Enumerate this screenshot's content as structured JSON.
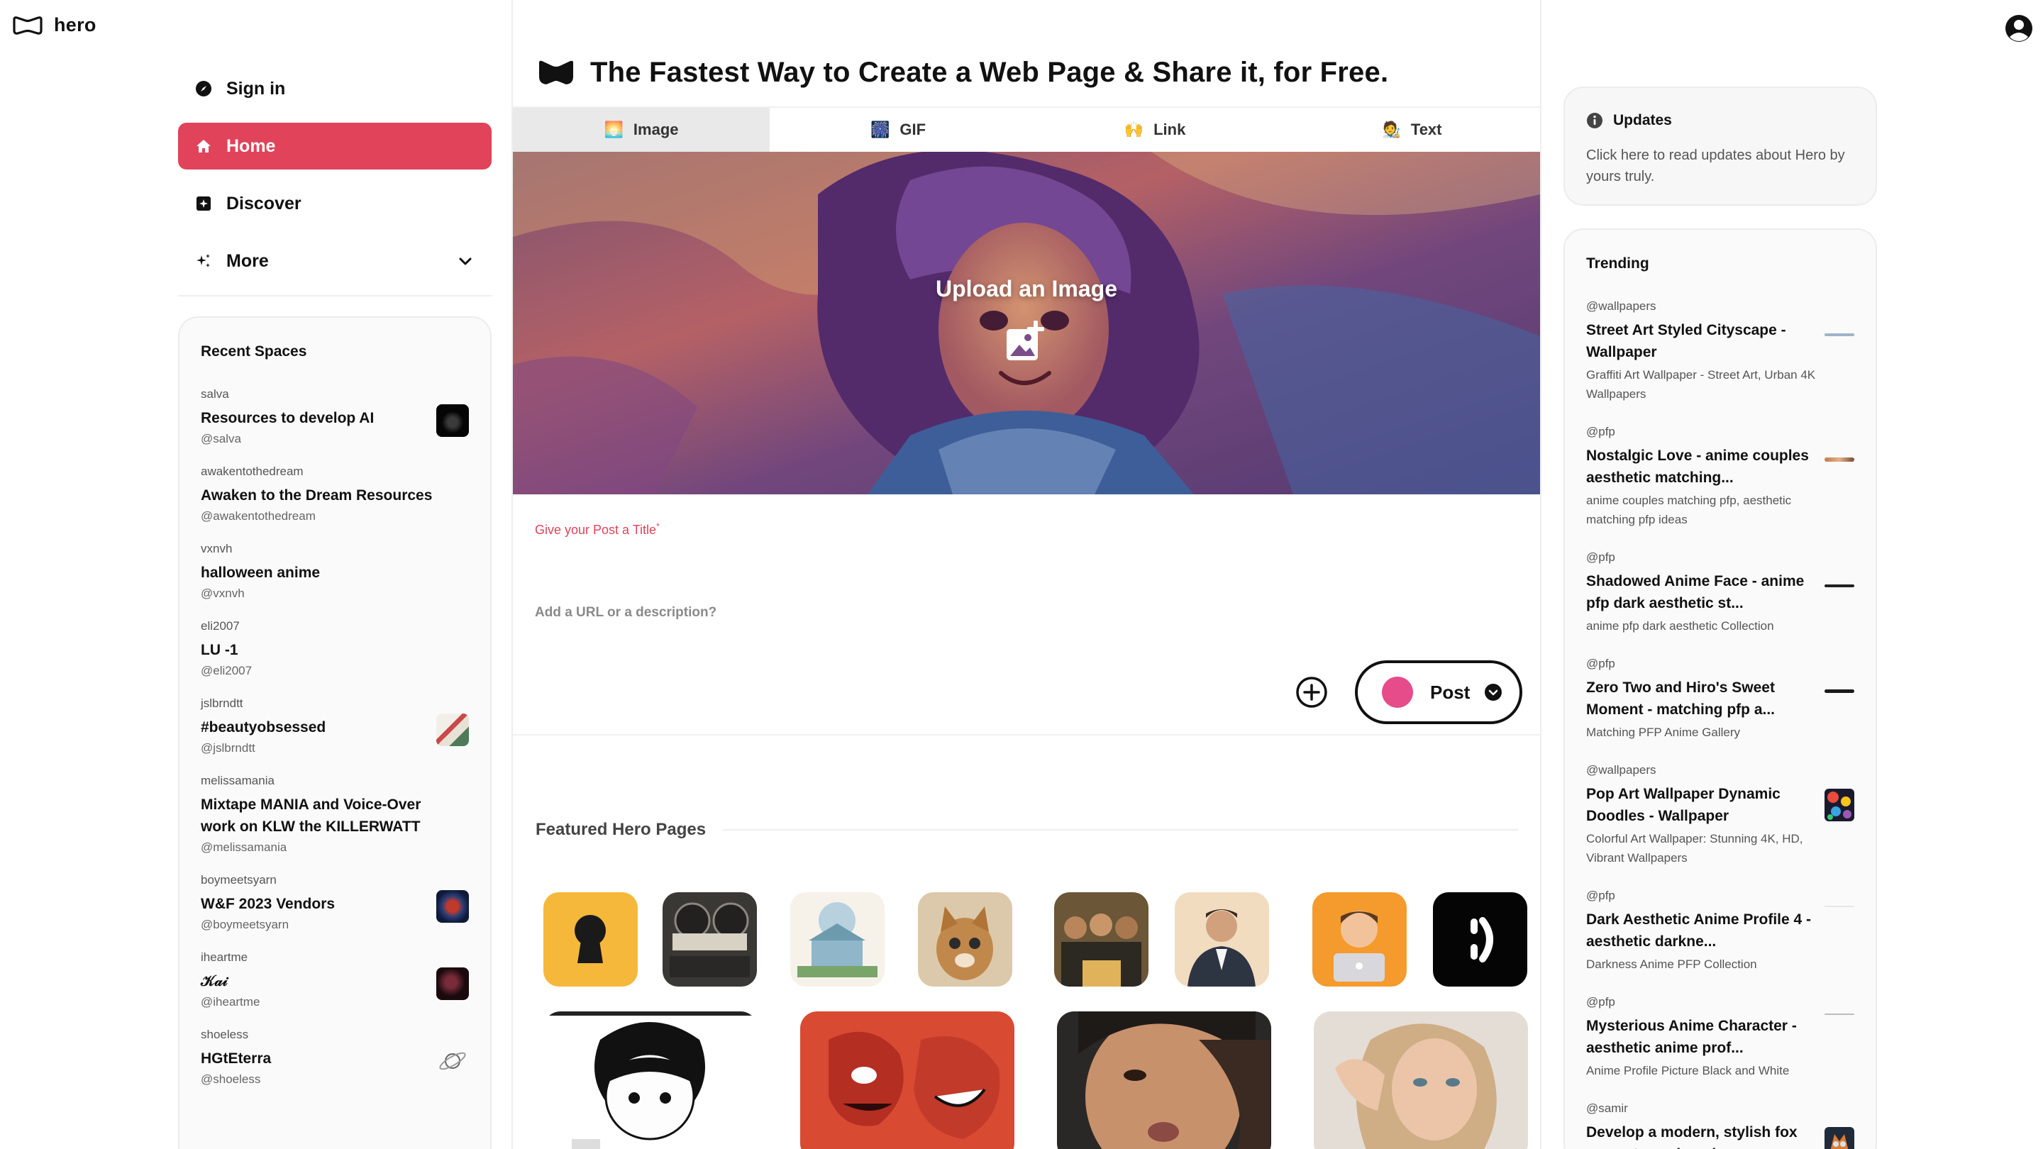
{
  "app": {
    "name": "hero"
  },
  "nav": {
    "sign_in": "Sign in",
    "home": "Home",
    "discover": "Discover",
    "more": "More"
  },
  "recent_spaces": {
    "title": "Recent Spaces",
    "items": [
      {
        "owner": "salva",
        "title": "Resources to develop AI",
        "handle": "@salva"
      },
      {
        "owner": "awakentothedream",
        "title": "Awaken to the Dream Resources",
        "handle": "@awakentothedream"
      },
      {
        "owner": "vxnvh",
        "title": "halloween anime",
        "handle": "@vxnvh"
      },
      {
        "owner": "eli2007",
        "title": "LU -1",
        "handle": "@eli2007"
      },
      {
        "owner": "jslbrndtt",
        "title": "#beautyobsessed",
        "handle": "@jslbrndtt"
      },
      {
        "owner": "melissamania",
        "title": "Mixtape MANIA and Voice-Over work on KLW the KILLERWATT",
        "handle": "@melissamania"
      },
      {
        "owner": "boymeetsyarn",
        "title": "W&F 2023 Vendors",
        "handle": "@boymeetsyarn"
      },
      {
        "owner": "iheartme",
        "title": "𝒦𝒶𝒾",
        "handle": "@iheartme"
      },
      {
        "owner": "shoeless",
        "title": "HGtEterra",
        "handle": "@shoeless"
      }
    ]
  },
  "main": {
    "headline": "The Fastest Way to Create a Web Page & Share it, for Free.",
    "tabs": [
      {
        "label": "Image",
        "glyph": "🌅"
      },
      {
        "label": "GIF",
        "glyph": "🎆"
      },
      {
        "label": "Link",
        "glyph": "🙌"
      },
      {
        "label": "Text",
        "glyph": "🧑‍🎨"
      }
    ],
    "upload_label": "Upload an Image",
    "title_label": "Give your Post a Title",
    "title_required_mark": "*",
    "description_placeholder": "Add a URL or a description?",
    "post_button": "Post",
    "featured_title": "Featured Hero Pages"
  },
  "updates": {
    "title": "Updates",
    "body": "Click here to read updates about Hero by yours truly."
  },
  "trending": {
    "title": "Trending",
    "items": [
      {
        "user": "@wallpapers",
        "title": "Street Art Styled Cityscape - Wallpaper",
        "desc": "Graffiti Art Wallpaper - Street Art, Urban 4K Wallpapers"
      },
      {
        "user": "@pfp",
        "title": "Nostalgic Love - anime couples aesthetic matching...",
        "desc": "anime couples matching pfp, aesthetic matching pfp ideas"
      },
      {
        "user": "@pfp",
        "title": "Shadowed Anime Face - anime pfp dark aesthetic st...",
        "desc": "anime pfp dark aesthetic Collection"
      },
      {
        "user": "@pfp",
        "title": "Zero Two and Hiro's Sweet Moment - matching pfp a...",
        "desc": "Matching PFP Anime Gallery"
      },
      {
        "user": "@wallpapers",
        "title": "Pop Art Wallpaper Dynamic Doodles - Wallpaper",
        "desc": "Colorful Art Wallpaper: Stunning 4K, HD, Vibrant Wallpapers"
      },
      {
        "user": "@pfp",
        "title": "Dark Aesthetic Anime Profile 4 - aesthetic darkne...",
        "desc": "Darkness Anime PFP Collection"
      },
      {
        "user": "@pfp",
        "title": "Mysterious Anime Character - aesthetic anime prof...",
        "desc": "Anime Profile Picture Black and White"
      },
      {
        "user": "@samir",
        "title": "Develop a modern, stylish fox mascot wearing glas...",
        "desc": ""
      }
    ]
  },
  "colors": {
    "accent": "#e0435a",
    "post_avatar": "#e64b8a"
  }
}
